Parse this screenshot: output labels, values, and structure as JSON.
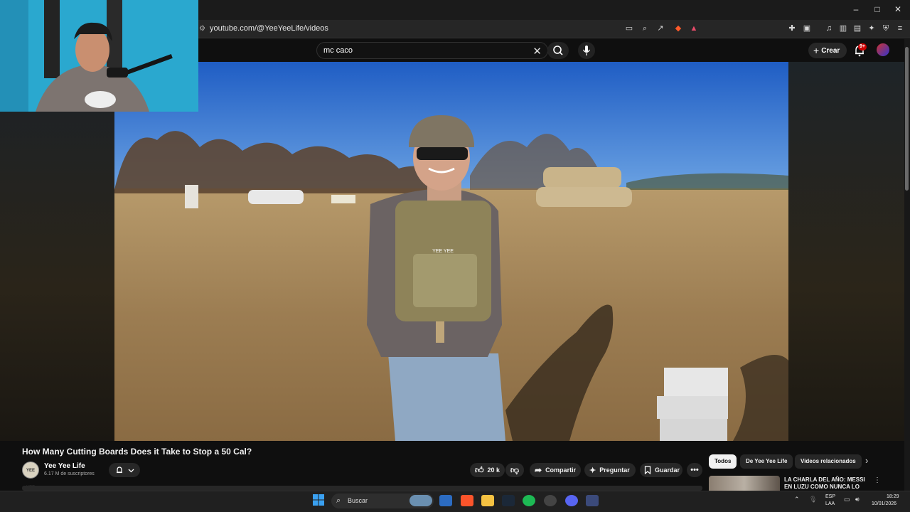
{
  "browser": {
    "url": "youtube.com/@YeeYeeLife/videos",
    "window_controls": [
      "–",
      "□",
      "✕"
    ]
  },
  "masthead": {
    "search_value": "mc caco",
    "create_label": "Crear",
    "notifications_badge": "9+"
  },
  "video": {
    "title": "How Many Cutting Boards Does it Take to Stop a 50 Cal?",
    "channel_name": "Yee Yee Life",
    "channel_avatar_text": "YEE YEE",
    "subscribers": "6.17 M de suscriptores",
    "like_count": "20 k",
    "share_label": "Compartir",
    "ask_label": "Preguntar",
    "save_label": "Guardar",
    "vest_patch": "YEE YEE"
  },
  "sidebar": {
    "chips": [
      "Todos",
      "De Yee Yee Life",
      "Videos relacionados"
    ],
    "related_title": "LA CHARLA DEL AÑO: MESSI EN LUZU COMO NUNCA LO"
  },
  "taskbar": {
    "search_placeholder": "Buscar",
    "lang_line1": "ESP",
    "lang_line2": "LAA",
    "time": "18:29",
    "date": "10/01/2026"
  },
  "colors": {
    "youtube_bg": "#0f0f0f",
    "accent_red": "#cc0000",
    "sky": "#2f6fcf",
    "grass": "#a8875a"
  }
}
